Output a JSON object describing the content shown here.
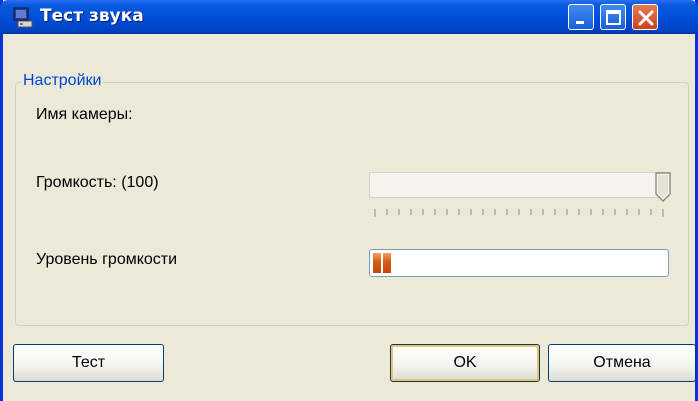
{
  "window": {
    "title": "Тест звука",
    "icon": "app-icon",
    "controls": [
      "minimize-icon",
      "maximize-icon",
      "close-icon"
    ]
  },
  "settings": {
    "group_label": "Настройки",
    "camera_name_label": "Имя камеры:",
    "volume_label": "Громкость: (100)",
    "volume_value": 100,
    "volume_max": 100,
    "level_label": "Уровень громкости",
    "level_segments": 2,
    "level_fraction": 0.06
  },
  "buttons": {
    "test": "Тест",
    "ok": "OK",
    "cancel": "Отмена"
  },
  "colors": {
    "title_bar": "#0050d8",
    "group_label": "#0046d5",
    "level_fill": "#d85a16",
    "close_button": "#c8421c"
  }
}
